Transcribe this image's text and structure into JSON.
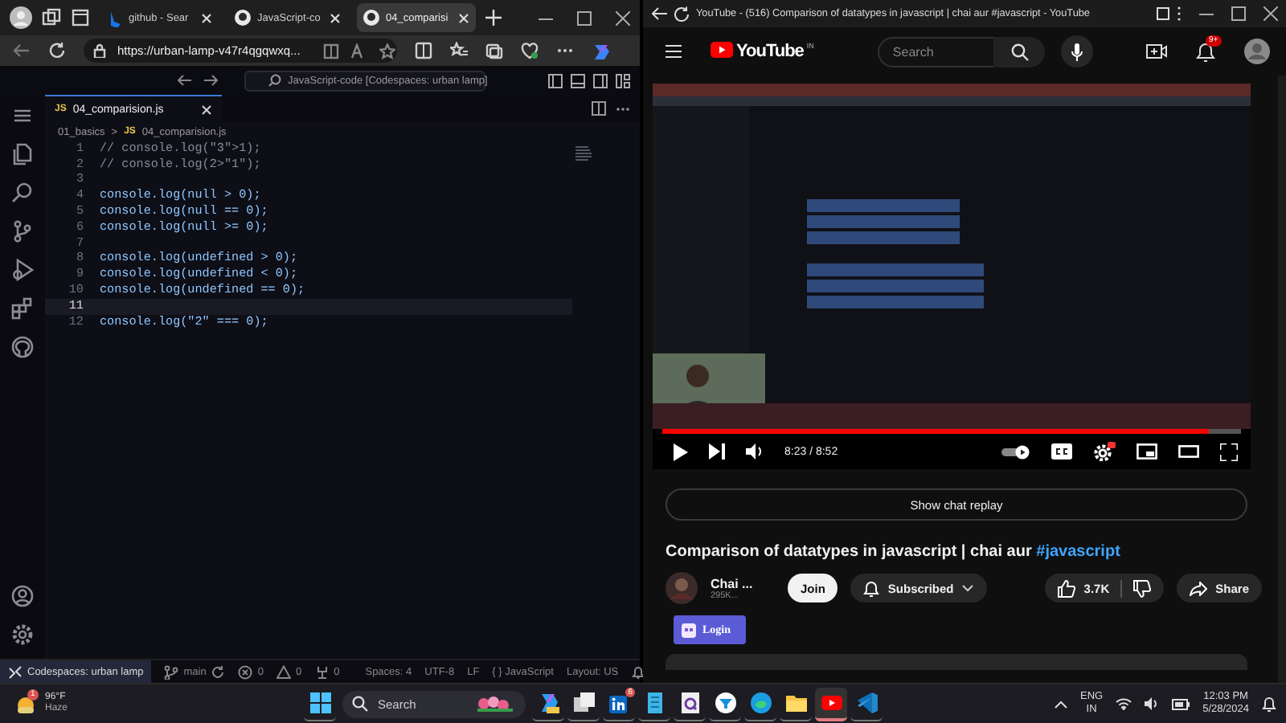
{
  "left_browser": {
    "tabs": [
      {
        "kind": "search",
        "label": "github - Sear",
        "selected": false
      },
      {
        "kind": "github",
        "label": "JavaScript-co",
        "selected": false
      },
      {
        "kind": "github",
        "label": "04_comparisi",
        "selected": true
      }
    ],
    "address": "https://urban-lamp-v47r4qgqwxq..."
  },
  "editor": {
    "title": "JavaScript-code [Codespaces: urban lamp]",
    "tab": {
      "badge": "JS",
      "label": "04_comparision.js"
    },
    "breadcrumb": {
      "folder": "01_basics",
      "separator": ">",
      "badge": "JS",
      "file": "04_comparision.js"
    },
    "lines": [
      {
        "number": "1",
        "kind": "comment",
        "text": "// console.log(\"3\">1);",
        "current": false
      },
      {
        "number": "2",
        "kind": "comment",
        "text": "// console.log(2>\"1\");",
        "current": false
      },
      {
        "number": "3",
        "current": false
      },
      {
        "number": "4",
        "kind": "code",
        "text": "console.log(null > 0);",
        "current": false
      },
      {
        "number": "5",
        "kind": "code",
        "text": "console.log(null == 0);",
        "current": false
      },
      {
        "number": "6",
        "kind": "code",
        "text": "console.log(null >= 0);",
        "current": false
      },
      {
        "number": "7",
        "current": false
      },
      {
        "number": "8",
        "kind": "code",
        "text": "console.log(undefined > 0);",
        "current": false
      },
      {
        "number": "9",
        "kind": "code",
        "text": "console.log(undefined < 0);",
        "current": false
      },
      {
        "number": "10",
        "kind": "code",
        "text": "console.log(undefined == 0);",
        "current": false
      },
      {
        "number": "11",
        "current": true
      },
      {
        "number": "12",
        "kind": "code",
        "text": "console.log(\"2\" === 0);",
        "current": false
      }
    ],
    "status_left": [
      {
        "kind": "remote",
        "label": "Codespaces: urban lamp"
      },
      {
        "kind": "branch",
        "label": "main"
      },
      {
        "kind": "errors",
        "label": "0"
      },
      {
        "kind": "warnings",
        "label": "0"
      },
      {
        "kind": "ports",
        "label": "0"
      }
    ],
    "status_right": [
      "Spaces: 4",
      "UTF-8",
      "LF",
      "{ } JavaScript",
      "Layout: US"
    ]
  },
  "youtube": {
    "window_title": "YouTube - (516) Comparison of datatypes in javascript | chai aur #javascript - YouTube",
    "logo": "YouTube",
    "region": "IN",
    "search_placeholder": "Search",
    "notifications": "9+",
    "player": {
      "progress": {
        "level": 0.945
      },
      "time": "8:23 / 8:52"
    },
    "chat_replay": "Show chat replay",
    "title": "Comparison of datatypes in javascript | chai aur ",
    "title_tag": "#javascript",
    "channel": {
      "name": "Chai ...",
      "subscribers": "295K..."
    },
    "join": "Join",
    "subscribe": "Subscribed",
    "likes": "3.7K",
    "share": "Share",
    "login": "Login"
  },
  "taskbar": {
    "weather": {
      "badge": "1",
      "temperature": "96°F",
      "condition": "Haze"
    },
    "search_placeholder": "Search",
    "apps": [
      {
        "kind": "start",
        "active": false
      },
      {
        "kind": "copilot",
        "active": false
      },
      {
        "kind": "taskview",
        "active": false
      },
      {
        "kind": "linkedin",
        "badge": "6",
        "active": false
      },
      {
        "kind": "notes",
        "active": false
      },
      {
        "kind": "torrent",
        "active": false
      },
      {
        "kind": "funnel",
        "active": false
      },
      {
        "kind": "edge",
        "active": false
      },
      {
        "kind": "folder",
        "active": false
      },
      {
        "kind": "youtube",
        "active": true
      },
      {
        "kind": "vscode",
        "active": false
      }
    ],
    "language": "ENG",
    "region": "IN",
    "time": "12:03 PM",
    "date": "5/28/2024"
  }
}
